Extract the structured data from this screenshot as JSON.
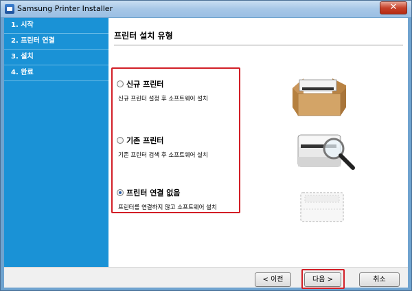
{
  "window": {
    "title": "Samsung Printer Installer",
    "close_label": "✕"
  },
  "steps": [
    {
      "label": "1. 시작"
    },
    {
      "label": "2. 프린터 연결"
    },
    {
      "label": "3. 설치"
    },
    {
      "label": "4. 완료"
    }
  ],
  "page": {
    "title": "프린터 설치 유형"
  },
  "options": [
    {
      "label": "신규 프린터",
      "description": "신규 프린터 설정 후 소프트웨어 설치",
      "checked": false
    },
    {
      "label": "기존 프린터",
      "description": "기존 프린터 검색 후 소프트웨어 설치",
      "checked": false
    },
    {
      "label": "프린터 연결 없음",
      "description": "프린터를 연결하지 않고 소프트웨어 설치",
      "checked": true
    }
  ],
  "buttons": {
    "prev": "< 이전",
    "next": "다음 >",
    "cancel": "취소"
  },
  "colors": {
    "sidebar": "#1a92d6",
    "highlight": "#d21e26"
  },
  "icons": {
    "new_printer": "printer-box-icon",
    "existing_printer": "printer-magnifier-icon",
    "no_printer": "printer-outline-icon"
  }
}
